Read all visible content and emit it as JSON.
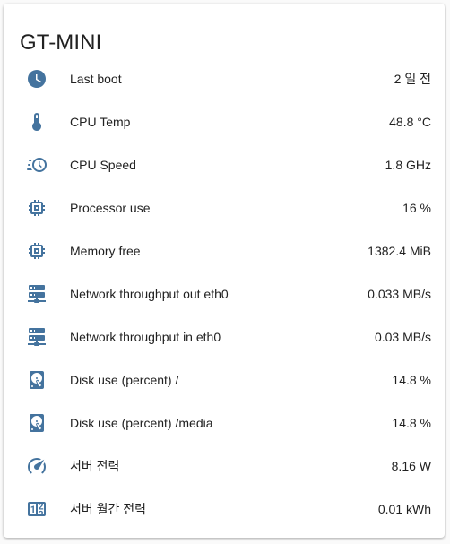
{
  "card": {
    "title": "GT-MINI",
    "icon_color": "#44739e"
  },
  "entities": [
    {
      "label": "Last boot",
      "value": "2 일 전",
      "icon": "clock-icon"
    },
    {
      "label": "CPU Temp",
      "value": "48.8 °C",
      "icon": "thermometer-icon"
    },
    {
      "label": "CPU Speed",
      "value": "1.8 GHz",
      "icon": "speedometer-clock-icon"
    },
    {
      "label": "Processor use",
      "value": "16 %",
      "icon": "chip-icon"
    },
    {
      "label": "Memory free",
      "value": "1382.4 MiB",
      "icon": "chip-icon"
    },
    {
      "label": "Network throughput out eth0",
      "value": "0.033 MB/s",
      "icon": "server-network-icon"
    },
    {
      "label": "Network throughput in eth0",
      "value": "0.03 MB/s",
      "icon": "server-network-icon"
    },
    {
      "label": "Disk use (percent) /",
      "value": "14.8 %",
      "icon": "harddisk-icon"
    },
    {
      "label": "Disk use (percent) /media",
      "value": "14.8 %",
      "icon": "harddisk-icon"
    },
    {
      "label": "서버 전력",
      "value": "8.16 W",
      "icon": "gauge-icon"
    },
    {
      "label": "서버 월간 전력",
      "value": "0.01 kWh",
      "icon": "counter-icon"
    }
  ]
}
